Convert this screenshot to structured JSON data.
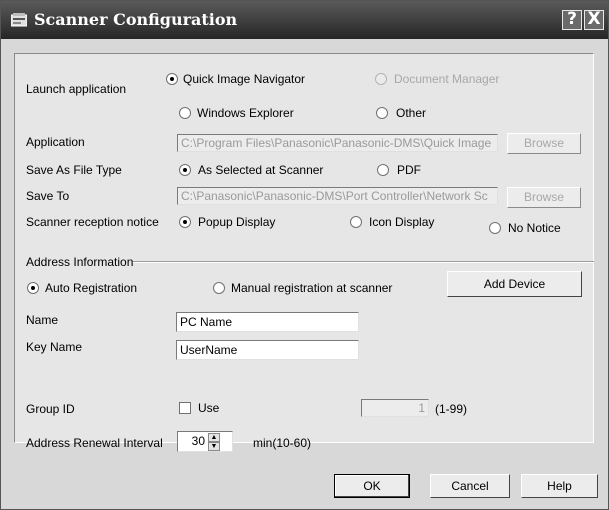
{
  "window": {
    "title": "Scanner Configuration",
    "help_glyph": "?",
    "close_glyph": "X"
  },
  "launch_application": {
    "label": "Launch application",
    "options": [
      {
        "label": "Quick Image Navigator",
        "selected": true,
        "enabled": true
      },
      {
        "label": "Document Manager",
        "selected": false,
        "enabled": false
      },
      {
        "label": "Windows Explorer",
        "selected": false,
        "enabled": true
      },
      {
        "label": "Other",
        "selected": false,
        "enabled": true
      }
    ]
  },
  "application": {
    "label": "Application",
    "value": "C:\\Program Files\\Panasonic\\Panasonic-DMS\\Quick Image",
    "browse_label": "Browse"
  },
  "save_as_file_type": {
    "label": "Save As File Type",
    "options": [
      {
        "label": "As Selected at Scanner",
        "selected": true
      },
      {
        "label": "PDF",
        "selected": false
      }
    ]
  },
  "save_to": {
    "label": "Save To",
    "value": "C:\\Panasonic\\Panasonic-DMS\\Port Controller\\Network Sc",
    "browse_label": "Browse"
  },
  "reception_notice": {
    "label": "Scanner reception notice",
    "options": [
      {
        "label": "Popup Display",
        "selected": true
      },
      {
        "label": "Icon Display",
        "selected": false
      },
      {
        "label": "No Notice",
        "selected": false
      }
    ]
  },
  "address_information": {
    "label": "Address Information",
    "auto_registration": "Auto Registration",
    "manual_registration": "Manual registration at scanner",
    "add_device_label": "Add Device",
    "name_label": "Name",
    "name_value": "PC Name",
    "key_name_label": "Key Name",
    "key_name_value": "UserName",
    "group_id_label": "Group ID",
    "use_label": "Use",
    "use_checked": false,
    "group_id_value": "1",
    "group_id_range": "(1-99)",
    "renewal_label": "Address Renewal Interval",
    "renewal_value": "30",
    "renewal_unit": "min(10-60)"
  },
  "buttons": {
    "ok": "OK",
    "cancel": "Cancel",
    "help": "Help"
  }
}
